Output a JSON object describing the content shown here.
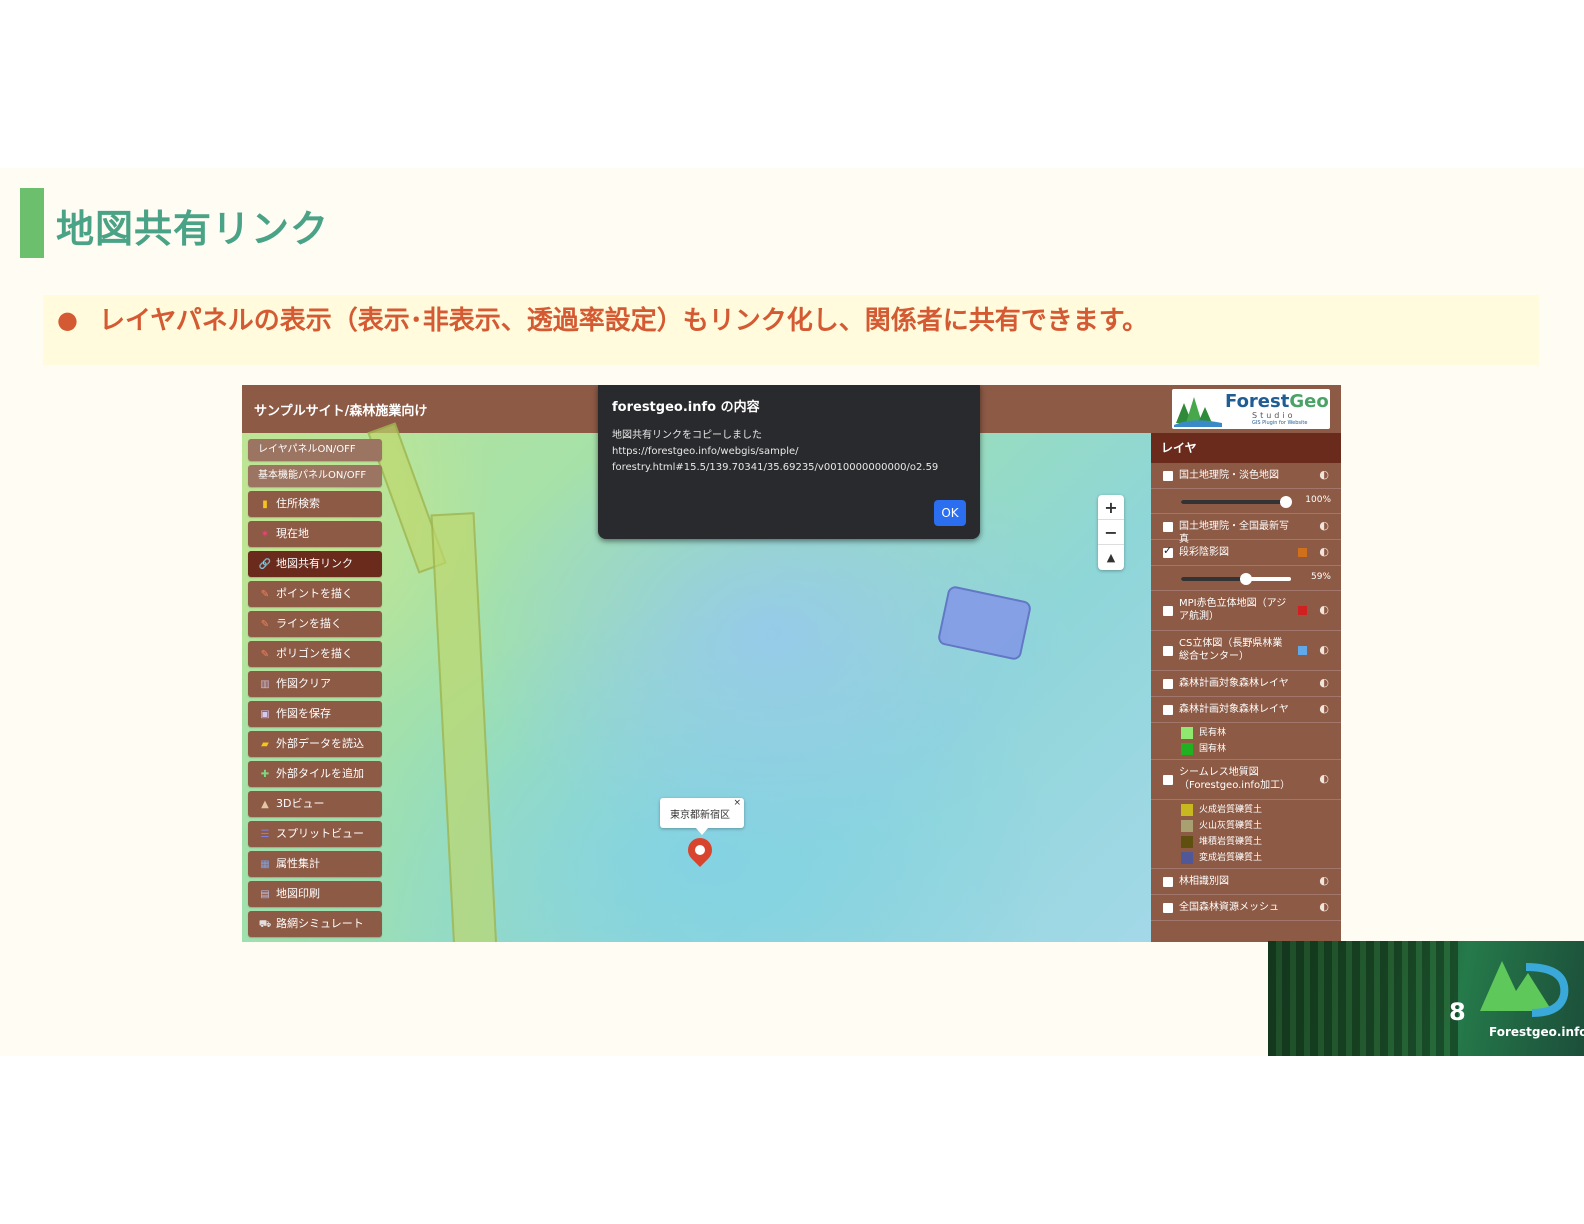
{
  "slide": {
    "title": "地図共有リンク",
    "bullet": "レイヤパネルの表示（表示･非表示、透過率設定）もリンク化し、関係者に共有できます。",
    "page_number": "8",
    "brand": "Forestgeo.info"
  },
  "app": {
    "title": "サンプルサイト/森林施業向け",
    "logo": {
      "name_a": "Forest",
      "name_b": "Geo",
      "sub": "Studio",
      "sub2": "GIS Plugin for Website"
    },
    "dialog": {
      "title": "forestgeo.info の内容",
      "message": "地図共有リンクをコピーしました\nhttps://forestgeo.info/webgis/sample/\nforestry.html#15.5/139.70341/35.69235/v0010000000000/o2.59",
      "ok_label": "OK"
    },
    "sidebar": [
      {
        "label": "レイヤパネルON/OFF",
        "icon": "",
        "style": "small"
      },
      {
        "label": "基本機能パネルON/OFF",
        "icon": "",
        "style": "small"
      },
      {
        "label": "住所検索",
        "icon": "▮",
        "icon_color": "#f5c518"
      },
      {
        "label": "現在地",
        "icon": "✶",
        "icon_color": "#e8467a"
      },
      {
        "label": "地図共有リンク",
        "icon": "🔗",
        "icon_color": "#ffffff",
        "active": true
      },
      {
        "label": "ポイントを描く",
        "icon": "✎",
        "icon_color": "#f08060"
      },
      {
        "label": "ラインを描く",
        "icon": "✎",
        "icon_color": "#f08060"
      },
      {
        "label": "ポリゴンを描く",
        "icon": "✎",
        "icon_color": "#f08060"
      },
      {
        "label": "作図クリア",
        "icon": "▥",
        "icon_color": "#c8b8d8"
      },
      {
        "label": "作図を保存",
        "icon": "▣",
        "icon_color": "#d8c8f0"
      },
      {
        "label": "外部データを読込",
        "icon": "▰",
        "icon_color": "#f5c518"
      },
      {
        "label": "外部タイルを追加",
        "icon": "✚",
        "icon_color": "#7ed67e"
      },
      {
        "label": "3Dビュー",
        "icon": "▲",
        "icon_color": "#e0c8a0"
      },
      {
        "label": "スプリットビュー",
        "icon": "☰",
        "icon_color": "#8080e0"
      },
      {
        "label": "属性集計",
        "icon": "▦",
        "icon_color": "#80a0e0"
      },
      {
        "label": "地図印刷",
        "icon": "▤",
        "icon_color": "#c0c0e8"
      },
      {
        "label": "路網シミュレート",
        "icon": "⛟",
        "icon_color": "#e0e0e0"
      }
    ],
    "zoom": {
      "in": "+",
      "out": "−",
      "north": "▲"
    },
    "popup": {
      "text": "東京都新宿区",
      "close": "×"
    },
    "layers_panel": {
      "title": "レイヤ",
      "items": [
        {
          "label": "国土地理院・淡色地図",
          "checked": false,
          "slider": "100%",
          "slider_fraction": 0.95
        },
        {
          "label": "国土地理院・全国最新写真",
          "checked": false
        },
        {
          "label": "段彩陰影図",
          "checked": true,
          "swatch": "#d0701c",
          "slider": "59%",
          "slider_fraction": 0.59
        },
        {
          "label": "MPI赤色立体地図（アジア航測）",
          "checked": false,
          "swatch": "#d02020"
        },
        {
          "label": "CS立体図（長野県林業総合センター）",
          "checked": false,
          "swatch": "#60a8e8"
        },
        {
          "label": "森林計画対象森林レイヤ",
          "checked": false
        },
        {
          "label": "森林計画対象森林レイヤ",
          "checked": false,
          "legend": [
            {
              "label": "民有林",
              "color": "#90e870"
            },
            {
              "label": "国有林",
              "color": "#20b020"
            }
          ]
        },
        {
          "label": "シームレス地質図（Forestgeo.info加工）",
          "checked": false,
          "legend": [
            {
              "label": "火成岩質礫質土",
              "color": "#c8b820"
            },
            {
              "label": "火山灰質礫質土",
              "color": "#a8a070"
            },
            {
              "label": "堆積岩質礫質土",
              "color": "#605010"
            },
            {
              "label": "変成岩質礫質土",
              "color": "#505898"
            }
          ]
        },
        {
          "label": "林相識別図",
          "checked": false
        },
        {
          "label": "全国森林資源メッシュ",
          "checked": false
        }
      ]
    }
  },
  "icons": {
    "opacity": "◐",
    "close": "×"
  }
}
